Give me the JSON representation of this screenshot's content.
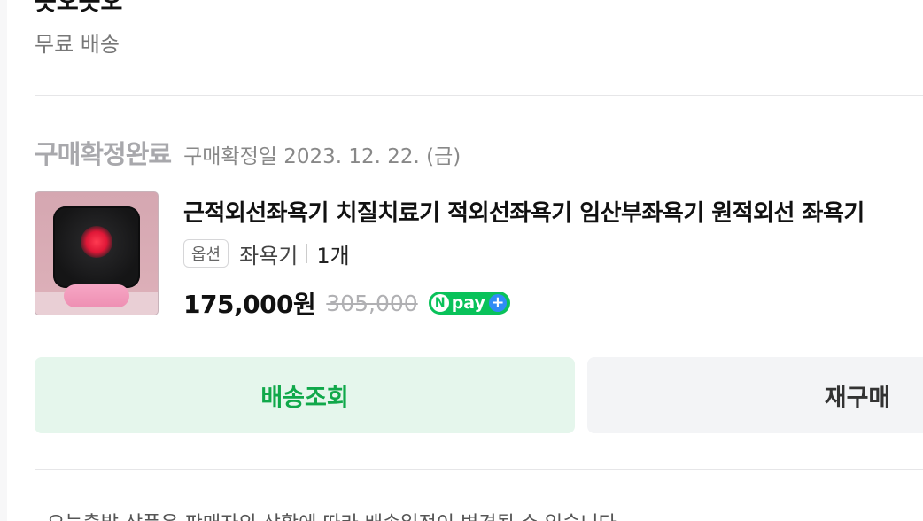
{
  "seller": {
    "name": "옷오옷오"
  },
  "shipping": {
    "label": "무료 배송"
  },
  "order": {
    "status": "구매확정완료",
    "confirm_date": "구매확정일 2023. 12. 22. (금)"
  },
  "product": {
    "name": "근적외선좌욕기 치질치료기 적외선좌욕기 임산부좌욕기 원적외선 좌욕기",
    "option_badge": "옵션",
    "option_text": "좌욕기",
    "quantity": "1개",
    "price": "175,000원",
    "original_price": "305,000",
    "pay_badge": "pay",
    "pay_badge_n": "N",
    "pay_badge_plus": "+"
  },
  "buttons": {
    "tracking": "배송조회",
    "rebuy": "재구매"
  },
  "notice": {
    "text": "· 오늘출발 상품은 판매자의 상황에 따라 배송일정이 변경될 수 있습니다."
  },
  "colors": {
    "accent_green": "#10a84a",
    "tracking_bg": "#e5f6ec",
    "npay_green": "#09c25a",
    "npay_plus_blue": "#2f8cf5"
  }
}
